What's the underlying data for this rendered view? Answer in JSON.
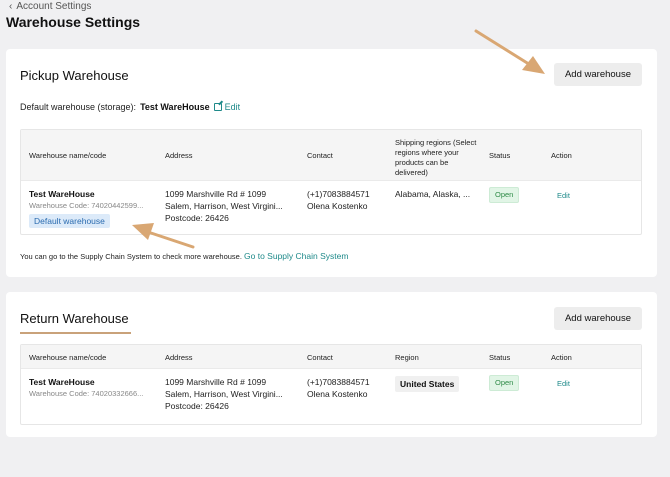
{
  "breadcrumb": {
    "label": "Account Settings"
  },
  "page_title": "Warehouse Settings",
  "pickup": {
    "title": "Pickup Warehouse",
    "add_button": "Add warehouse",
    "default_label": "Default warehouse (storage):",
    "default_name": "Test WareHouse",
    "edit_label": "Edit",
    "columns": [
      "Warehouse name/code",
      "Address",
      "Contact",
      "Shipping regions (Select regions where your products can be delivered)",
      "Status",
      "Action"
    ],
    "rows": [
      {
        "name": "Test WareHouse",
        "code": "Warehouse Code: 74020442599...",
        "badge": "Default warehouse",
        "address1": "1099 Marshville Rd # 1099",
        "address2": "Salem, Harrison, West Virgini...",
        "address3": "Postcode: 26426",
        "phone": "(+1)7083884571",
        "contact_name": "Olena Kostenko",
        "regions": "Alabama, Alaska, ...",
        "status": "Open",
        "action": "Edit"
      }
    ],
    "note_text": "You can go to the Supply Chain System to check more warehouse.",
    "note_link": "Go to Supply Chain System"
  },
  "return": {
    "title": "Return Warehouse",
    "add_button": "Add warehouse",
    "columns": [
      "Warehouse name/code",
      "Address",
      "Contact",
      "Region",
      "Status",
      "Action"
    ],
    "rows": [
      {
        "name": "Test WareHouse",
        "code": "Warehouse Code: 74020332666...",
        "address1": "1099 Marshville Rd # 1099",
        "address2": "Salem, Harrison, West Virgini...",
        "address3": "Postcode: 26426",
        "phone": "(+1)7083884571",
        "contact_name": "Olena Kostenko",
        "region": "United States",
        "status": "Open",
        "action": "Edit"
      }
    ]
  },
  "colors": {
    "accent_link": "#1f8a8a",
    "arrow": "#d9a773",
    "open_badge": "#2e8b47",
    "default_badge": "#2b6cb0"
  }
}
